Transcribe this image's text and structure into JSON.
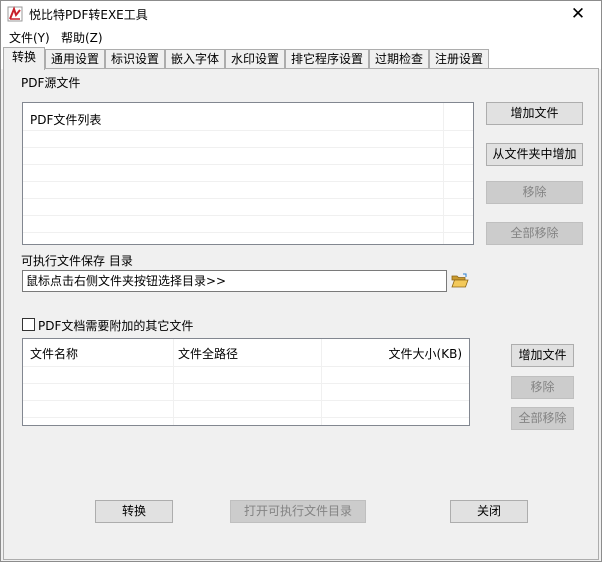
{
  "window": {
    "title": "悦比特PDF转EXE工具",
    "close_glyph": "✕"
  },
  "menu": {
    "file": "文件(Y)",
    "help": "帮助(Z)"
  },
  "tabs": [
    {
      "label": "转换",
      "active": true
    },
    {
      "label": "通用设置"
    },
    {
      "label": "标识设置"
    },
    {
      "label": "嵌入字体"
    },
    {
      "label": "水印设置"
    },
    {
      "label": "排它程序设置"
    },
    {
      "label": "过期检查"
    },
    {
      "label": "注册设置"
    }
  ],
  "pdf_source": {
    "section_label": "PDF源文件",
    "list_header": "PDF文件列表",
    "add_file": "增加文件",
    "add_from_folder": "从文件夹中增加",
    "remove": "移除",
    "remove_all": "全部移除"
  },
  "output": {
    "label": "可执行文件保存 目录",
    "path_value": "鼠标点击右侧文件夹按钮选择目录>>",
    "folder_icon": "folder-open-icon"
  },
  "attachments": {
    "checkbox_label": "PDF文档需要附加的其它文件",
    "checked": false,
    "columns": [
      "文件名称",
      "文件全路径",
      "文件大小(KB)"
    ],
    "add_file": "增加文件",
    "remove": "移除",
    "remove_all": "全部移除"
  },
  "footer": {
    "convert": "转换",
    "open_output_dir": "打开可执行文件目录",
    "close": "关闭"
  },
  "colors": {
    "pdf_icon_red": "#c8202a",
    "folder_yellow": "#e8b84a"
  }
}
